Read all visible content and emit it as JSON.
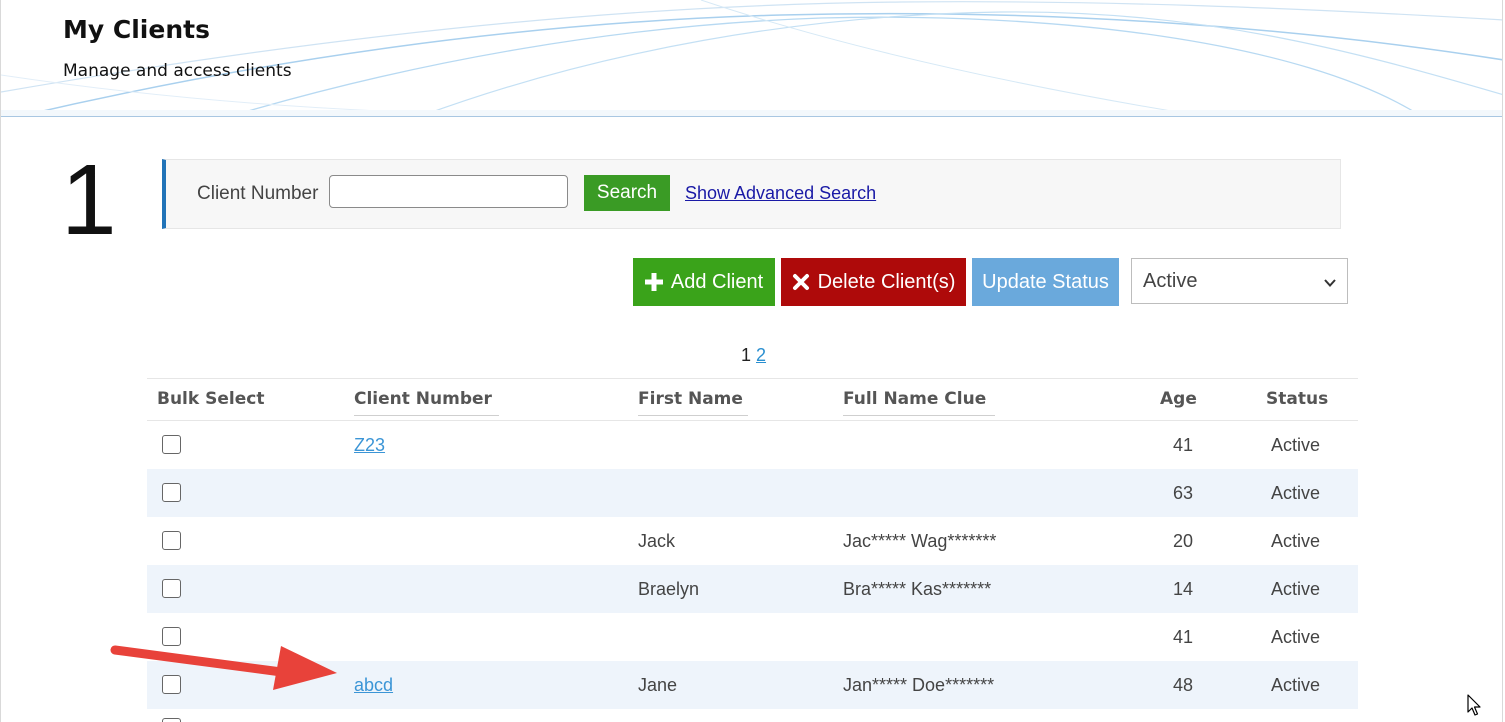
{
  "header": {
    "title": "My Clients",
    "subtitle": "Manage and access clients"
  },
  "step_number": "1",
  "search": {
    "label": "Client Number",
    "value": "",
    "placeholder": "",
    "button_label": "Search",
    "advanced_link": "Show Advanced Search"
  },
  "toolbar": {
    "add_label": "Add Client",
    "delete_label": "Delete Client(s)",
    "update_label": "Update Status",
    "status_selected": "Active",
    "colors": {
      "add": "#3aa31a",
      "delete": "#ae0a0a",
      "update": "#6aa9dc"
    }
  },
  "pagination": {
    "current": "1",
    "next": "2"
  },
  "table": {
    "headers": {
      "bulk_select": "Bulk Select",
      "client_number": "Client Number",
      "first_name": "First Name",
      "full_name_clue": "Full Name Clue",
      "age": "Age",
      "status": "Status"
    },
    "rows": [
      {
        "client_number": "Z23",
        "first_name": "",
        "full_name_clue": "",
        "age": "41",
        "status": "Active"
      },
      {
        "client_number": "",
        "first_name": "",
        "full_name_clue": "",
        "age": "63",
        "status": "Active"
      },
      {
        "client_number": "",
        "first_name": "Jack",
        "full_name_clue": "Jac***** Wag*******",
        "age": "20",
        "status": "Active"
      },
      {
        "client_number": "",
        "first_name": "Braelyn",
        "full_name_clue": "Bra***** Kas*******",
        "age": "14",
        "status": "Active"
      },
      {
        "client_number": "",
        "first_name": "",
        "full_name_clue": "",
        "age": "41",
        "status": "Active"
      },
      {
        "client_number": "abcd",
        "first_name": "Jane",
        "full_name_clue": "Jan***** Doe*******",
        "age": "48",
        "status": "Active"
      }
    ]
  },
  "annotation": {
    "arrow_color": "#e8423a"
  }
}
